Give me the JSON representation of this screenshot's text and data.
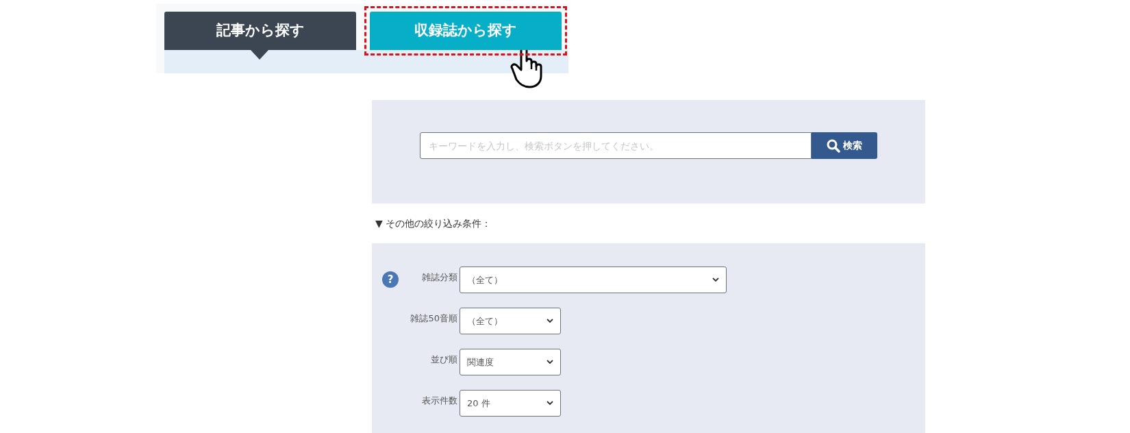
{
  "tabs": [
    {
      "label": "記事から探す",
      "selected": true,
      "highlighted": false
    },
    {
      "label": "収録誌から探す",
      "selected": false,
      "highlighted": true
    }
  ],
  "search": {
    "placeholder": "キーワードを入力し、検索ボタンを押してください。",
    "button": "検索"
  },
  "filters_toggle": {
    "marker": "▼",
    "label": "その他の絞り込み条件："
  },
  "filters": [
    {
      "help": "?",
      "label": "雑誌分類",
      "value": "（全て）",
      "wide": true
    },
    {
      "label": "雑誌50音順",
      "value": "（全て）",
      "wide": false
    },
    {
      "label": "並び順",
      "value": "関連度",
      "wide": false
    },
    {
      "label": "表示件数",
      "value": "20 件",
      "wide": false
    }
  ]
}
